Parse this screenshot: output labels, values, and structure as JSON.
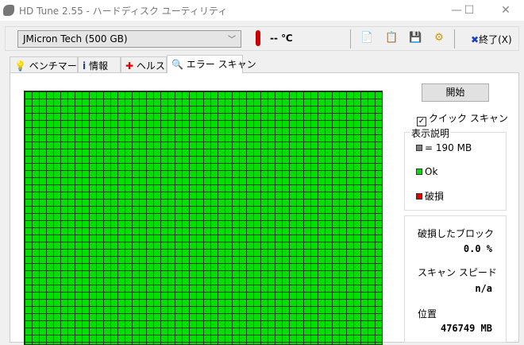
{
  "window": {
    "title": "HD Tune 2.55 - ハードディスク ユーティリティ",
    "minimize": "—",
    "maximize": "☐",
    "close": "✕"
  },
  "toolbar": {
    "drive": "JMicron Tech (500 GB)",
    "temperature": "-- ℃",
    "exit_label": "終了(X)"
  },
  "tabs": [
    {
      "label": "ベンチマーク"
    },
    {
      "label": "情報"
    },
    {
      "label": "ヘルス"
    },
    {
      "label": "エラー スキャン"
    }
  ],
  "scan": {
    "start_label": "開始",
    "quick_scan_label": "クイック スキャン",
    "quick_scan_checked": true
  },
  "legend": {
    "title": "表示説明",
    "block_size": "= 190 MB",
    "ok": "Ok",
    "damaged": "破損",
    "colors": {
      "ok": "#00e000",
      "damaged": "#e00000",
      "block": "#808080"
    }
  },
  "stats": {
    "damaged_blocks_label": "破損したブロック",
    "damaged_blocks_value": "0.0 %",
    "speed_label": "スキャン スピード",
    "speed_value": "n/a",
    "position_label": "位置",
    "position_value": "476749 MB"
  }
}
